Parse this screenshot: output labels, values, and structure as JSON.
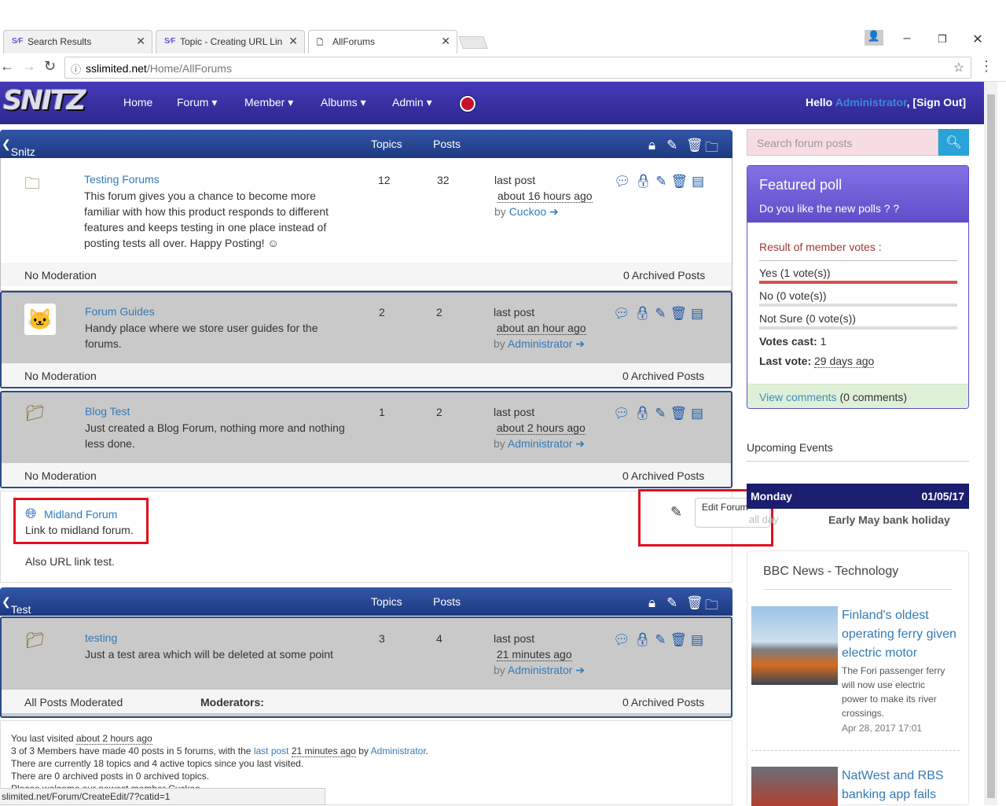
{
  "browser": {
    "tabs": [
      {
        "label": "Search Results",
        "favicon": "S∕F"
      },
      {
        "label": "Topic - Creating URL Lin",
        "favicon": "S∕F"
      },
      {
        "label": "AllForums",
        "favicon": "page-icon"
      }
    ],
    "url_host": "sslimited.net",
    "url_path": "/Home/AllForums",
    "status_url": "slimited.net/Forum/CreateEdit/7?catid=1"
  },
  "nav": {
    "logo": "SNITZ",
    "items": [
      "Home",
      "Forum",
      "Member",
      "Albums",
      "Admin"
    ],
    "hello": "Hello",
    "user": "Administrator",
    "signout": ", [Sign Out]"
  },
  "categories": [
    {
      "title": "Snitz Forums Mvc",
      "topics_label": "Topics",
      "posts_label": "Posts"
    },
    {
      "title": "Test Only",
      "topics_label": "Topics",
      "posts_label": "Posts"
    }
  ],
  "forums": [
    {
      "title": "Testing Forums",
      "desc": "This forum gives you a chance to become more familiar with how this product responds to different features and keeps testing in one place instead of posting tests all over. Happy Posting! ☺",
      "topics": "12",
      "posts": "32",
      "last_label": "last post",
      "last_time": "about 16 hours ago",
      "by": "by",
      "author": "Cuckoo",
      "moderation": "No Moderation",
      "archived": "0 Archived Posts"
    },
    {
      "title": "Forum Guides",
      "desc": "Handy place where we store user guides for the forums.",
      "topics": "2",
      "posts": "2",
      "last_label": "last post",
      "last_time": "about an hour ago",
      "by": "by",
      "author": "Administrator",
      "moderation": "No Moderation",
      "archived": "0 Archived Posts"
    },
    {
      "title": "Blog Test",
      "desc": "Just created a Blog Forum, nothing more and nothing less done.",
      "topics": "1",
      "posts": "2",
      "last_label": "last post",
      "last_time": "about 2 hours ago",
      "by": "by",
      "author": "Administrator",
      "moderation": "No Moderation",
      "archived": "0 Archived Posts"
    },
    {
      "title": "testing",
      "desc": "Just a test area which will be deleted at some point",
      "topics": "3",
      "posts": "4",
      "last_label": "last post",
      "last_time": "21 minutes ago",
      "by": "by",
      "author": "Administrator",
      "moderation": "All Posts Moderated",
      "moderators": "Moderators:",
      "archived": "0 Archived Posts"
    }
  ],
  "link_forum": {
    "title": "Midland Forum",
    "desc": "Link to midland forum.",
    "note": "Also URL link test.",
    "tooltip": "Edit Forum"
  },
  "sidebar": {
    "search_placeholder": "Search forum posts",
    "poll_title": "Featured poll",
    "poll_question": "Do you like the new polls ? ?",
    "result_label": "Result of member votes :",
    "options": [
      {
        "label": "Yes (1 vote(s))",
        "share": 1.0
      },
      {
        "label": "No (0 vote(s))",
        "share": 0
      },
      {
        "label": "Not Sure (0 vote(s))",
        "share": 0
      }
    ],
    "votes_cast_label": "Votes cast:",
    "votes_cast": "1",
    "last_vote_label": "Last vote:",
    "last_vote": "29 days ago",
    "view_comments": "View comments",
    "comments_count": "(0 comments)",
    "events_title": "Upcoming Events",
    "event_day": "Monday",
    "event_date": "01/05/17",
    "event_allday": "all day",
    "event_name": "Early May bank holiday",
    "news_title": "BBC News - Technology",
    "news": [
      {
        "title": "Finland's oldest operating ferry given electric motor",
        "summary": "The Fori passenger ferry will now use electric power to make its river crossings.",
        "date": "Apr 28, 2017 17:01"
      },
      {
        "title": "NatWest and RBS banking app fails"
      }
    ]
  },
  "stats": {
    "line1_a": "You last visited",
    "line1_b": "about 2 hours ago",
    "line2_a": "3 of 3 Members have made 40 posts in 5 forums, with the",
    "line2_link": "last post",
    "line2_time": "21 minutes ago",
    "line2_by": "by",
    "line2_user": "Administrator",
    "line3": "There are currently 18 topics and 4 active topics since you last visited.",
    "line4": "There are 0 archived posts in 0 archived topics.",
    "line5": "Please welcome our newest member Cuckoo"
  },
  "colors": {
    "navbar": "#3a30a8",
    "category": "#274a94",
    "poll_header": "#6f5fd8",
    "accent": "#2aa3d8",
    "highlight": "#e0101e"
  }
}
